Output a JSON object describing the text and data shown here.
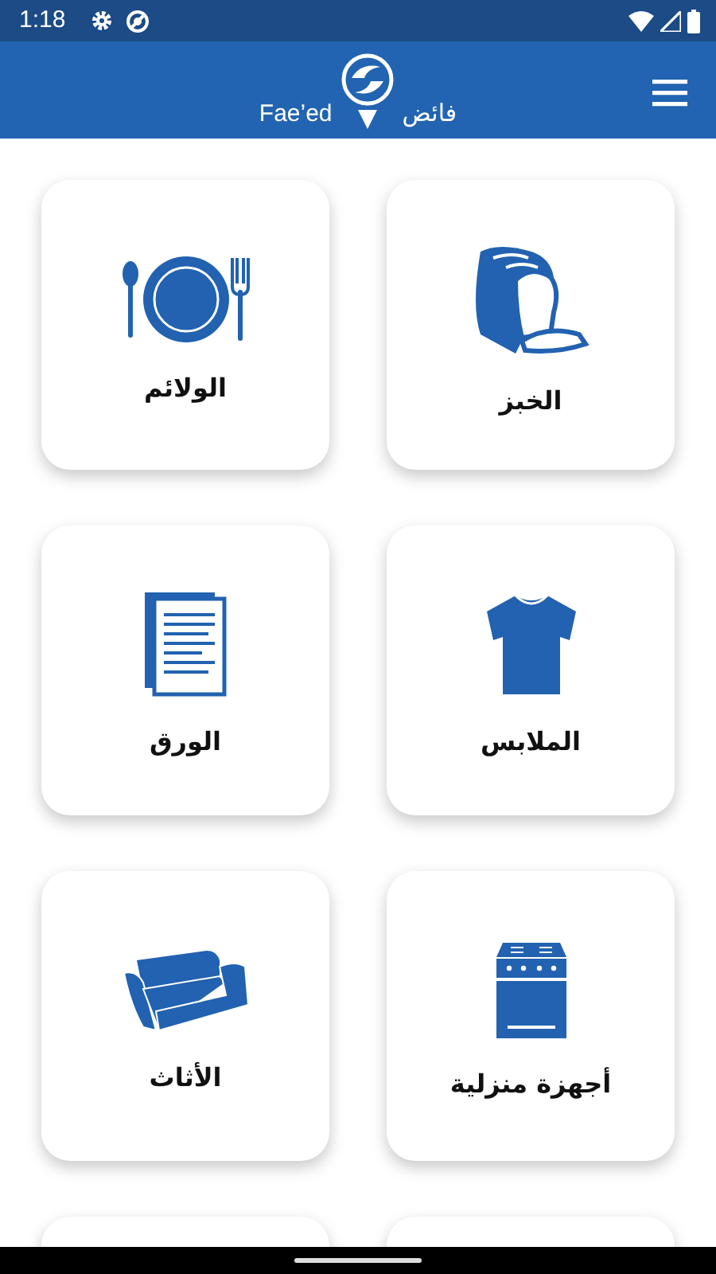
{
  "status_bar": {
    "time": "1:18"
  },
  "header": {
    "brand_latin": "Fae’ed",
    "brand_arabic": "فائض"
  },
  "categories": [
    {
      "kind": "bread",
      "label": "الخبز"
    },
    {
      "kind": "dining",
      "label": "الولائم"
    },
    {
      "kind": "clothes",
      "label": "الملابس"
    },
    {
      "kind": "paper",
      "label": "الورق"
    },
    {
      "kind": "appliance",
      "label": "أجهزة منزلية"
    },
    {
      "kind": "furniture",
      "label": "الأثاث"
    },
    {
      "kind": "cut-off"
    },
    {
      "kind": "cut-off"
    }
  ]
}
